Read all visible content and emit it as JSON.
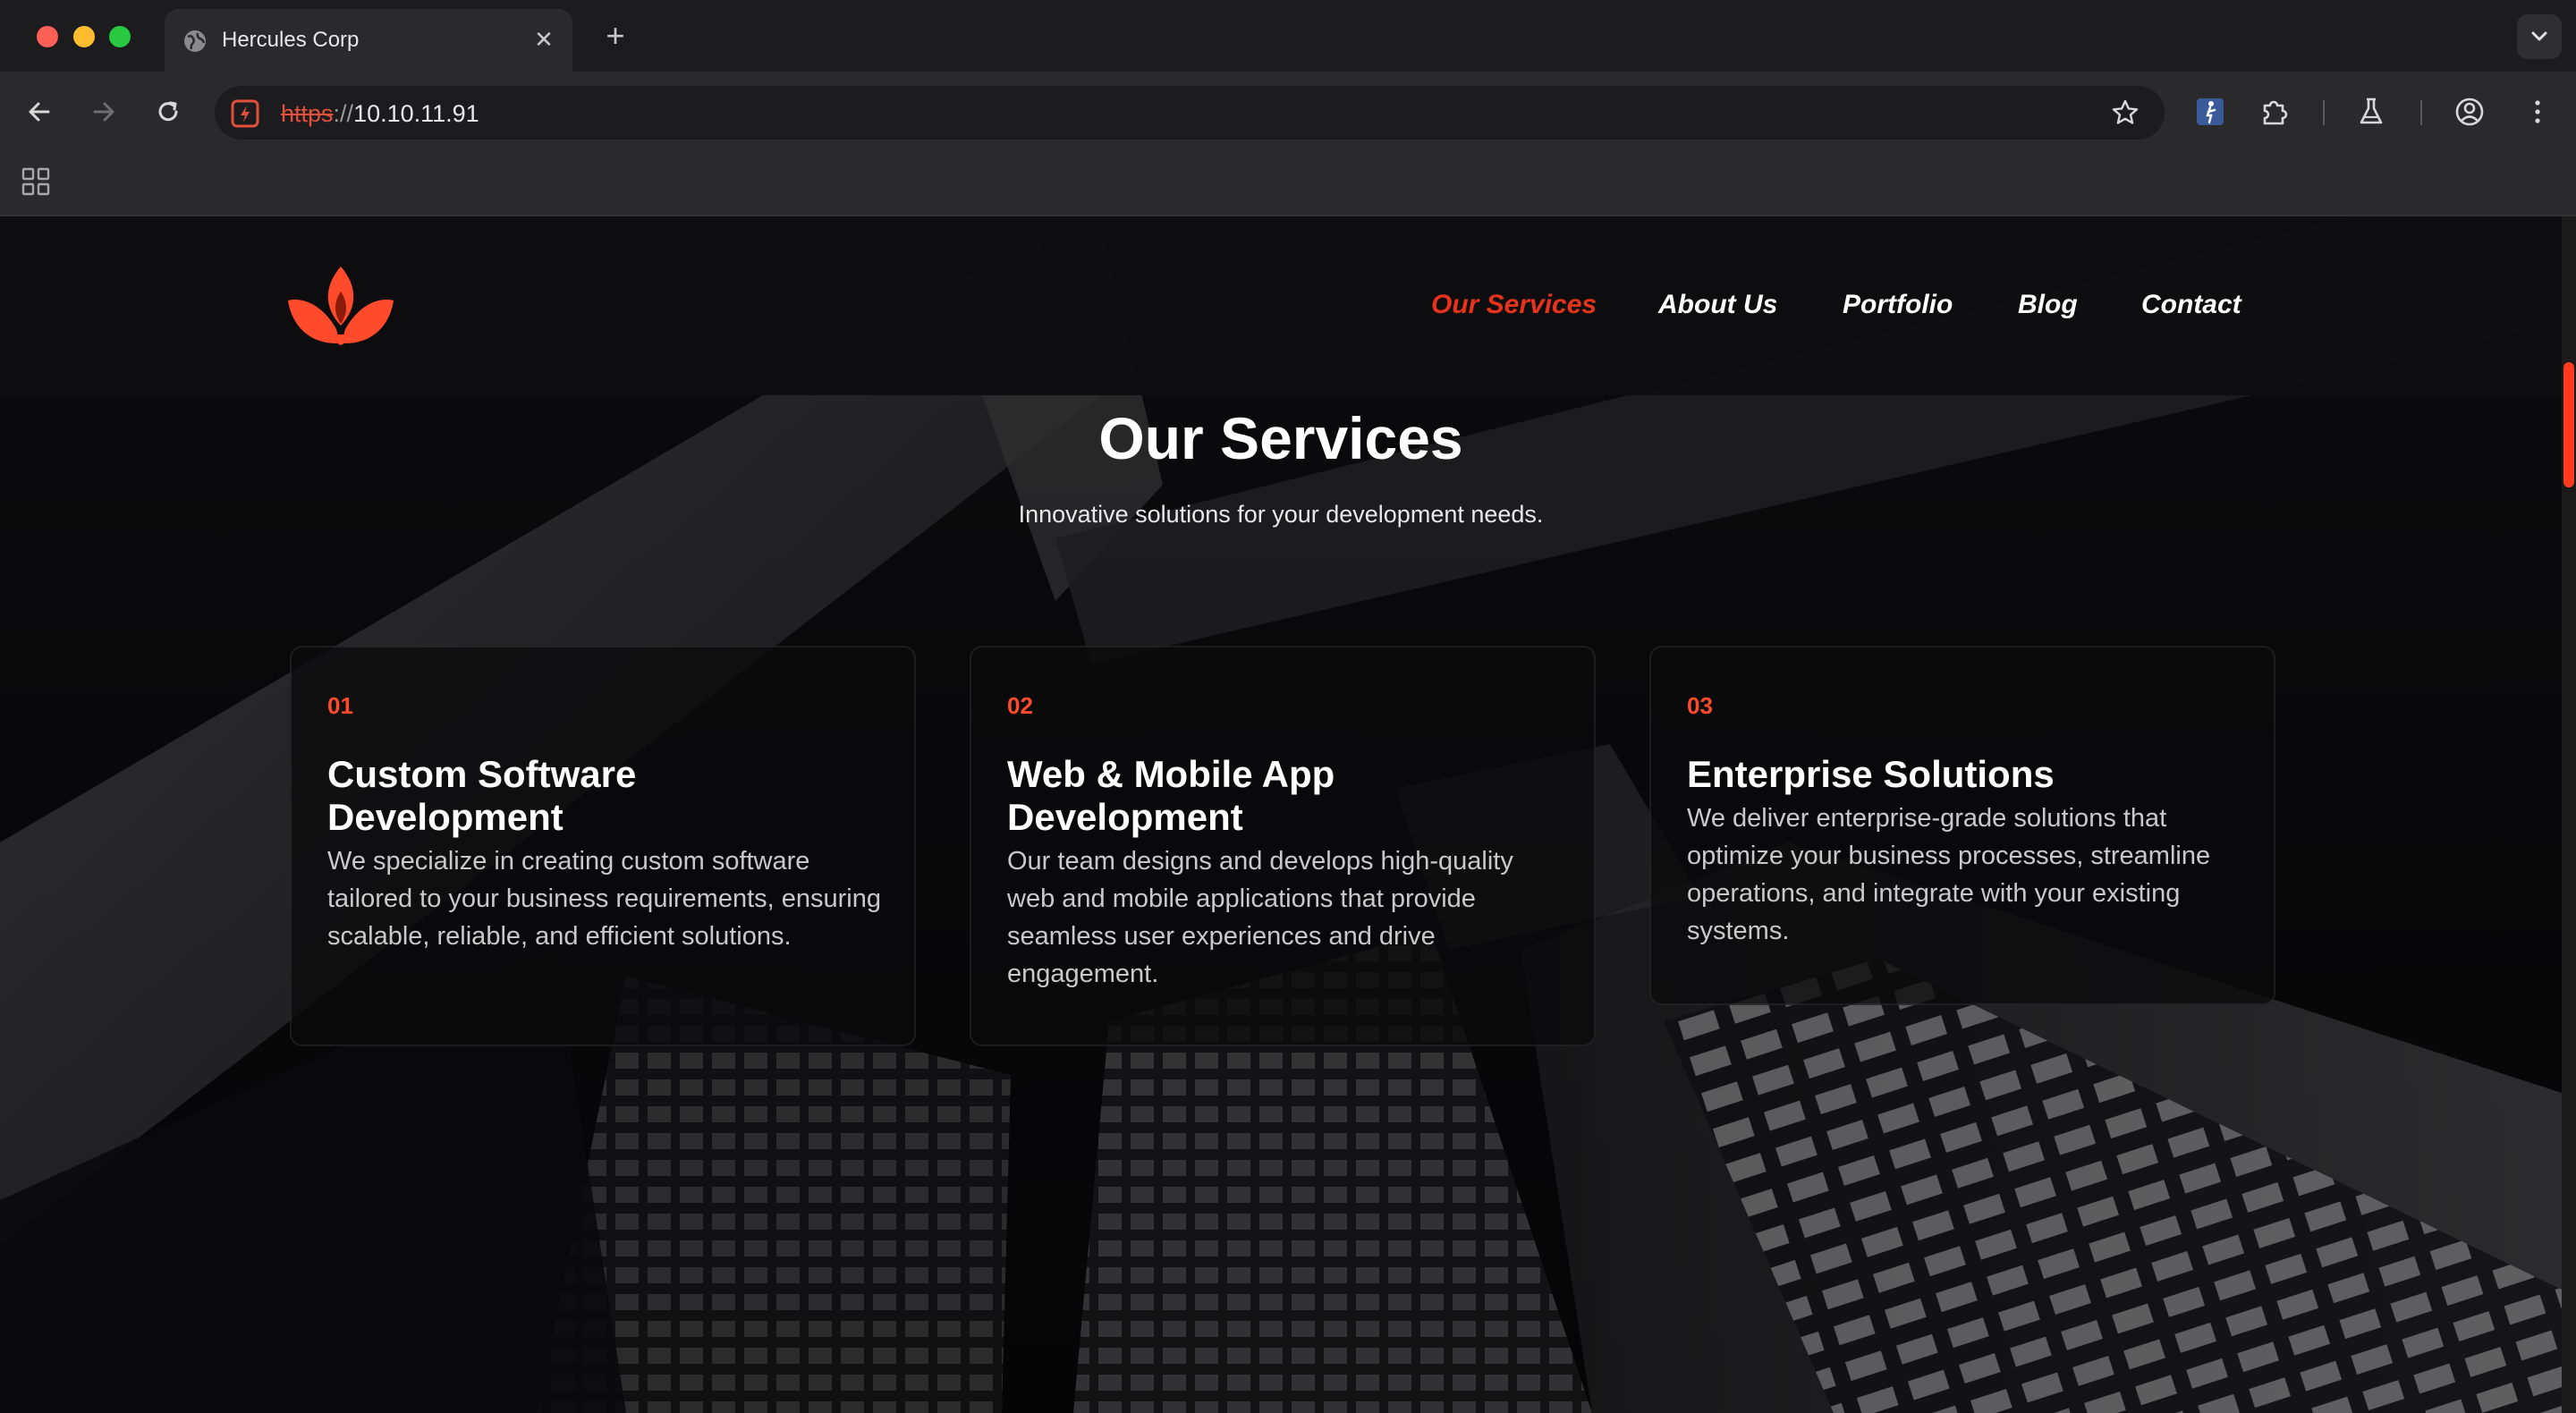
{
  "browser": {
    "tab": {
      "title": "Hercules Corp",
      "close_glyph": "✕"
    },
    "new_tab_glyph": "+",
    "address": {
      "scheme": "https",
      "separator": "://",
      "host": "10.10.11.91"
    },
    "icons": {
      "back": "arrow-left-icon",
      "forward": "arrow-right-icon",
      "reload": "reload-icon",
      "site_info": "not-secure-icon",
      "bookmark": "star-icon",
      "extension_1": "accessibility-extension-icon",
      "extensions": "puzzle-icon",
      "labs": "flask-icon",
      "profile": "profile-icon",
      "menu": "kebab-menu-icon",
      "apps": "apps-grid-icon",
      "tab_search": "chevron-down-icon"
    }
  },
  "site": {
    "brand_color": "#ff4b2b",
    "nav": [
      {
        "label": "Our Services",
        "active": true
      },
      {
        "label": "About Us",
        "active": false
      },
      {
        "label": "Portfolio",
        "active": false
      },
      {
        "label": "Blog",
        "active": false
      },
      {
        "label": "Contact",
        "active": false
      }
    ],
    "section": {
      "title": "Our Services",
      "subtitle": "Innovative solutions for your development needs."
    },
    "cards": [
      {
        "number": "01",
        "title": "Custom Software Development",
        "description": "We specialize in creating custom software tailored to your business requirements, ensuring scalable, reliable, and efficient solutions."
      },
      {
        "number": "02",
        "title": "Web & Mobile App Development",
        "description": "Our team designs and develops high-quality web and mobile applications that provide seamless user experiences and drive engagement."
      },
      {
        "number": "03",
        "title": "Enterprise Solutions",
        "description": "We deliver enterprise-grade solutions that optimize your business processes, streamline operations, and integrate with your existing systems."
      }
    ]
  }
}
